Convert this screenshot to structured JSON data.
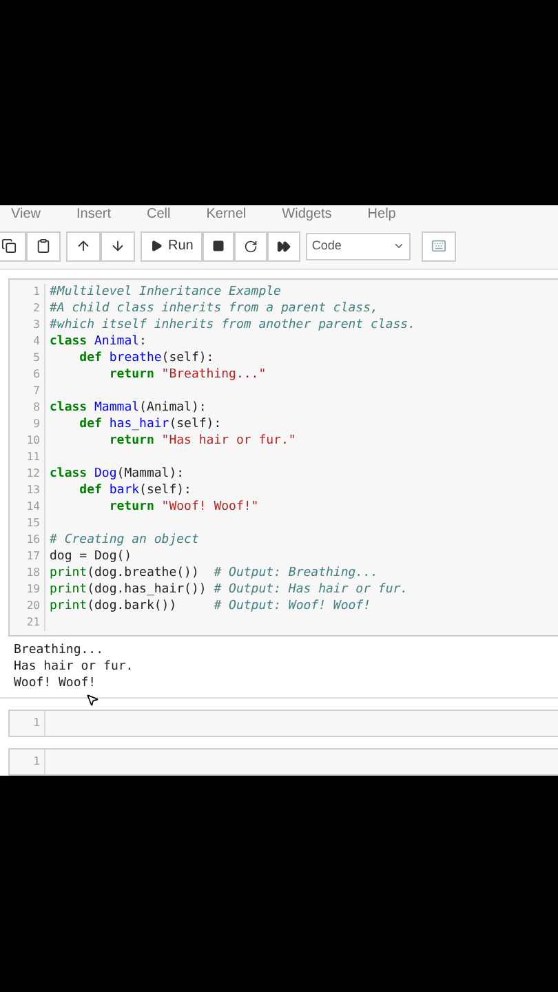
{
  "menu": [
    "View",
    "Insert",
    "Cell",
    "Kernel",
    "Widgets",
    "Help"
  ],
  "toolbar": {
    "run_label": "Run",
    "cell_type": "Code"
  },
  "code_cell": {
    "lines": [
      {
        "number": "1",
        "tokens": [
          {
            "text": "#Multilevel Inheritance Example",
            "kind": "comment"
          }
        ]
      },
      {
        "number": "2",
        "tokens": [
          {
            "text": "#A child class inherits from a parent class,",
            "kind": "comment"
          }
        ]
      },
      {
        "number": "3",
        "tokens": [
          {
            "text": "#which itself inherits from another parent class.",
            "kind": "comment"
          }
        ]
      },
      {
        "number": "4",
        "tokens": [
          {
            "text": "class ",
            "kind": "keyword"
          },
          {
            "text": "Animal",
            "kind": "def"
          },
          {
            "text": ":",
            "kind": "plain"
          }
        ]
      },
      {
        "number": "5",
        "tokens": [
          {
            "text": "    def ",
            "kind": "keyword"
          },
          {
            "text": "breathe",
            "kind": "def"
          },
          {
            "text": "(self):",
            "kind": "plain"
          }
        ]
      },
      {
        "number": "6",
        "tokens": [
          {
            "text": "        return ",
            "kind": "keyword"
          },
          {
            "text": "\"Breathing...\"",
            "kind": "string"
          }
        ]
      },
      {
        "number": "7"
      },
      {
        "number": "8",
        "tokens": [
          {
            "text": "class ",
            "kind": "keyword"
          },
          {
            "text": "Mammal",
            "kind": "def"
          },
          {
            "text": "(Animal):",
            "kind": "plain"
          }
        ]
      },
      {
        "number": "9",
        "tokens": [
          {
            "text": "    def ",
            "kind": "keyword"
          },
          {
            "text": "has_hair",
            "kind": "def"
          },
          {
            "text": "(self):",
            "kind": "plain"
          }
        ]
      },
      {
        "number": "10",
        "tokens": [
          {
            "text": "        return ",
            "kind": "keyword"
          },
          {
            "text": "\"Has hair or fur.\"",
            "kind": "string"
          }
        ]
      },
      {
        "number": "11"
      },
      {
        "number": "12",
        "tokens": [
          {
            "text": "class ",
            "kind": "keyword"
          },
          {
            "text": "Dog",
            "kind": "def"
          },
          {
            "text": "(Mammal):",
            "kind": "plain"
          }
        ]
      },
      {
        "number": "13",
        "tokens": [
          {
            "text": "    def ",
            "kind": "keyword"
          },
          {
            "text": "bark",
            "kind": "def"
          },
          {
            "text": "(self):",
            "kind": "plain"
          }
        ]
      },
      {
        "number": "14",
        "tokens": [
          {
            "text": "        return ",
            "kind": "keyword"
          },
          {
            "text": "\"Woof! Woof!\"",
            "kind": "string"
          }
        ]
      },
      {
        "number": "15"
      },
      {
        "number": "16",
        "tokens": [
          {
            "text": "# Creating an object",
            "kind": "comment"
          }
        ]
      },
      {
        "number": "17",
        "tokens": [
          {
            "text": "dog = Dog()",
            "kind": "plain"
          }
        ]
      },
      {
        "number": "18",
        "tokens": [
          {
            "text": "print",
            "kind": "builtin"
          },
          {
            "text": "(dog.breathe())  ",
            "kind": "plain"
          },
          {
            "text": "# Output: Breathing...",
            "kind": "comment"
          }
        ]
      },
      {
        "number": "19",
        "tokens": [
          {
            "text": "print",
            "kind": "builtin"
          },
          {
            "text": "(dog.has_hair()) ",
            "kind": "plain"
          },
          {
            "text": "# Output: Has hair or fur.",
            "kind": "comment"
          }
        ]
      },
      {
        "number": "20",
        "tokens": [
          {
            "text": "print",
            "kind": "builtin"
          },
          {
            "text": "(dog.bark())     ",
            "kind": "plain"
          },
          {
            "text": "# Output: Woof! Woof!",
            "kind": "comment"
          }
        ]
      },
      {
        "number": "21"
      }
    ]
  },
  "output": [
    "Breathing...",
    "Has hair or fur.",
    "Woof! Woof!"
  ],
  "empty_cells": [
    {
      "line_number": "1"
    },
    {
      "line_number": "1"
    }
  ]
}
